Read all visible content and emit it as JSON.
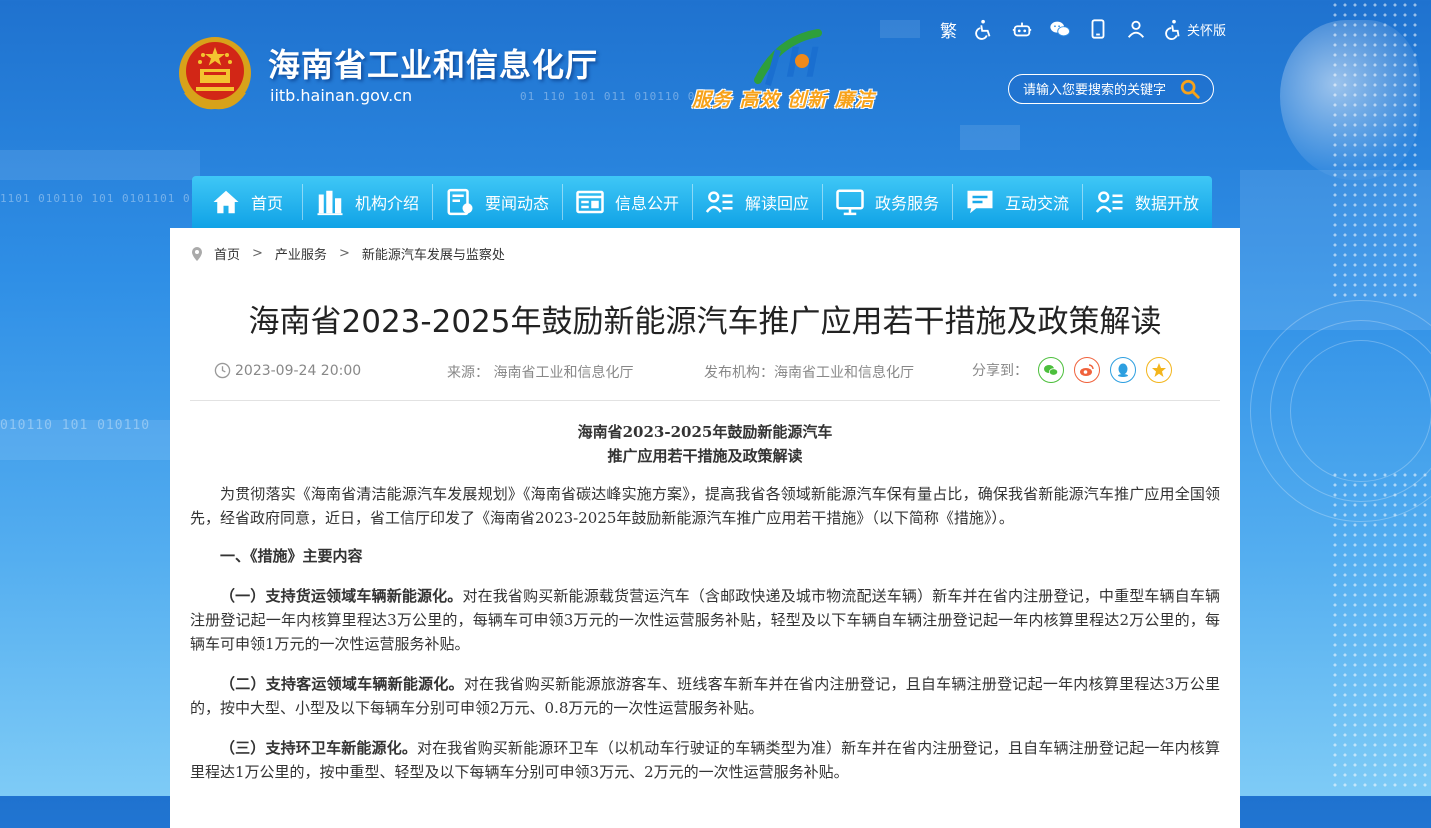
{
  "site": {
    "title": "海南省工业和信息化厅",
    "domain": "iitb.hainan.gov.cn",
    "slogan": "服务 高效 创新 廉洁"
  },
  "topbar": {
    "traditional_label": "繁",
    "care_label": "关怀版",
    "icons": [
      "accessibility-icon",
      "robot-icon",
      "wechat-icon",
      "mobile-icon",
      "user-icon",
      "care-mode-icon"
    ]
  },
  "search": {
    "placeholder": "请输入您要搜索的关键字"
  },
  "nav": {
    "items": [
      {
        "label": "首页",
        "icon": "home-icon"
      },
      {
        "label": "机构介绍",
        "icon": "building-icon"
      },
      {
        "label": "要闻动态",
        "icon": "news-icon"
      },
      {
        "label": "信息公开",
        "icon": "info-icon"
      },
      {
        "label": "解读回应",
        "icon": "interpret-icon"
      },
      {
        "label": "政务服务",
        "icon": "monitor-icon"
      },
      {
        "label": "互动交流",
        "icon": "chat-icon"
      },
      {
        "label": "数据开放",
        "icon": "data-icon"
      }
    ]
  },
  "breadcrumb": {
    "items": [
      "首页",
      "产业服务",
      "新能源汽车发展与监察处"
    ],
    "separator": ">"
  },
  "article": {
    "title": "海南省2023-2025年鼓励新能源汽车推广应用若干措施及政策解读",
    "date": "2023-09-24 20:00",
    "source_label": "来源：",
    "source": "海南省工业和信息化厅",
    "publisher_label": "发布机构：",
    "publisher": "海南省工业和信息化厅",
    "share_label": "分享到：",
    "share_colors": {
      "wechat": "#4cbf3c",
      "weibo": "#f0623c",
      "qq": "#2d9fe0",
      "qzone": "#f3b51c"
    },
    "subtitle_line1": "海南省2023-2025年鼓励新能源汽车",
    "subtitle_line2": "推广应用若干措施及政策解读",
    "intro": "为贯彻落实《海南省清洁能源汽车发展规划》《海南省碳达峰实施方案》，提高我省各领域新能源汽车保有量占比，确保我省新能源汽车推广应用全国领先，经省政府同意，近日，省工信厅印发了《海南省2023-2025年鼓励新能源汽车推广应用若干措施》（以下简称《措施》）。",
    "section1": "一、《措施》主要内容",
    "p1_bold": "（一）支持货运领域车辆新能源化。",
    "p1_text": "对在我省购买新能源载货营运汽车（含邮政快递及城市物流配送车辆）新车并在省内注册登记，中重型车辆自车辆注册登记起一年内核算里程达3万公里的，每辆车可申领3万元的一次性运营服务补贴，轻型及以下车辆自车辆注册登记起一年内核算里程达2万公里的，每辆车可申领1万元的一次性运营服务补贴。",
    "p2_bold": "（二）支持客运领域车辆新能源化。",
    "p2_text": "对在我省购买新能源旅游客车、班线客车新车并在省内注册登记，且自车辆注册登记起一年内核算里程达3万公里的，按中大型、小型及以下每辆车分别可申领2万元、0.8万元的一次性运营服务补贴。",
    "p3_bold": "（三）支持环卫车新能源化。",
    "p3_text": "对在我省购买新能源环卫车（以机动车行驶证的车辆类型为准）新车并在省内注册登记，且自车辆注册登记起一年内核算里程达1万公里的，按中重型、轻型及以下每辆车分别可申领3万元、2万元的一次性运营服务补贴。"
  }
}
